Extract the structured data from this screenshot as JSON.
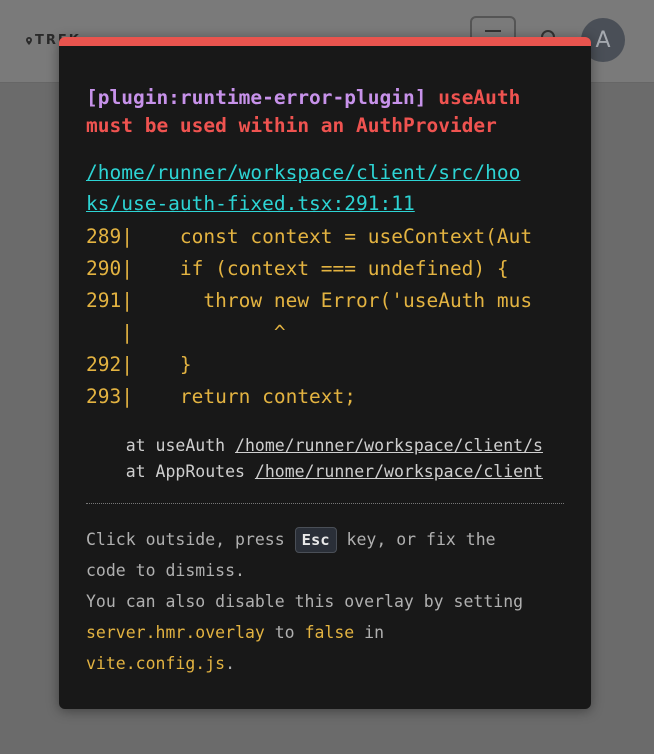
{
  "header": {
    "logo_text": "TREK"
  },
  "avatar": {
    "initial": "A"
  },
  "overlay": {
    "plugin_tag": "[plugin:runtime-error-plugin]",
    "message_part1": " useAuth",
    "message_part2": "must be used within an AuthProvider",
    "file_line1": "/home/runner/workspace/client/src/hoo",
    "file_line2": "ks/use-auth-fixed.tsx:291:11",
    "code_frame": [
      "289|    const context = useContext(Aut",
      "290|    if (context === undefined) {",
      "291|      throw new Error('useAuth mus",
      "   |            ^",
      "292|    }",
      "293|    return context;"
    ],
    "stack": [
      {
        "fn": "    at useAuth ",
        "loc": "/home/runner/workspace/client/s"
      },
      {
        "fn": "    at AppRoutes ",
        "loc": "/home/runner/workspace/client"
      }
    ],
    "tip": {
      "click_text": "Click outside, press ",
      "esc_key": "Esc",
      "key_text": " key, or fix the",
      "code_text": "code to dismiss.",
      "disable_text": "You can also disable this overlay by setting",
      "setting": "server.hmr.overlay",
      "to_text": " to ",
      "false_text": "false",
      "in_text": " in",
      "config_file": "vite.config.js",
      "period": "."
    }
  },
  "colors": {
    "accent_bar": "#e8544e",
    "plugin": "#c792ea",
    "message": "#ef5350",
    "file_link": "#2dd4d4",
    "code": "#e3b341",
    "overlay_bg": "#181818"
  },
  "icons": [
    "map-pin-icon",
    "menu-icon",
    "search-icon"
  ]
}
